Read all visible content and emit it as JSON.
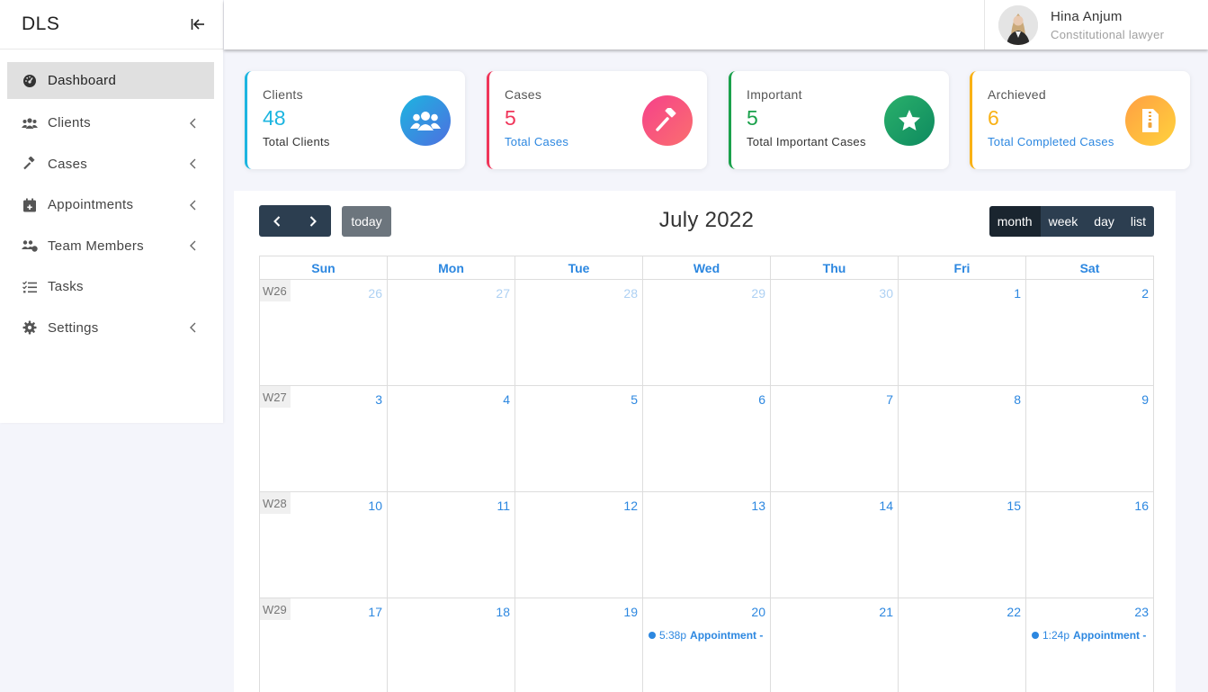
{
  "sidebar": {
    "brand": "DLS",
    "items": [
      {
        "label": "Dashboard",
        "icon": "dashboard-icon"
      },
      {
        "label": "Clients",
        "icon": "users-icon"
      },
      {
        "label": "Cases",
        "icon": "gavel-icon"
      },
      {
        "label": "Appointments",
        "icon": "calendar-plus-icon"
      },
      {
        "label": "Team Members",
        "icon": "team-icon"
      },
      {
        "label": "Tasks",
        "icon": "tasks-icon"
      },
      {
        "label": "Settings",
        "icon": "gear-icon"
      }
    ]
  },
  "profile": {
    "name": "Hina Anjum",
    "role": "Constitutional lawyer"
  },
  "cards": [
    {
      "label": "Clients",
      "value": "48",
      "sub": "Total Clients",
      "color": "#1cb5e0",
      "icon": "users-icon"
    },
    {
      "label": "Cases",
      "value": "5",
      "sub": "Total Cases",
      "color": "#f0365a",
      "icon": "gavel-icon"
    },
    {
      "label": "Important",
      "value": "5",
      "sub": "Total Important Cases",
      "color": "#1aa14b",
      "icon": "star-icon"
    },
    {
      "label": "Archieved",
      "value": "6",
      "sub": "Total Completed Cases",
      "color": "#f9b115",
      "icon": "archive-file-icon"
    }
  ],
  "calendar": {
    "title": "July 2022",
    "today_label": "today",
    "views": [
      "month",
      "week",
      "day",
      "list"
    ],
    "active_view": "month",
    "weekdays": [
      "Sun",
      "Mon",
      "Tue",
      "Wed",
      "Thu",
      "Fri",
      "Sat"
    ],
    "weeks": [
      {
        "label": "W26",
        "days": [
          "26",
          "27",
          "28",
          "29",
          "30",
          "1",
          "2"
        ]
      },
      {
        "label": "W27",
        "days": [
          "3",
          "4",
          "5",
          "6",
          "7",
          "8",
          "9"
        ]
      },
      {
        "label": "W28",
        "days": [
          "10",
          "11",
          "12",
          "13",
          "14",
          "15",
          "16"
        ]
      },
      {
        "label": "W29",
        "days": [
          "17",
          "18",
          "19",
          "20",
          "21",
          "22",
          "23"
        ]
      }
    ],
    "events": [
      {
        "week": 3,
        "day": 3,
        "time": "5:38p",
        "title": "Appointment -"
      },
      {
        "week": 3,
        "day": 6,
        "time": "1:24p",
        "title": "Appointment - ..."
      }
    ]
  }
}
